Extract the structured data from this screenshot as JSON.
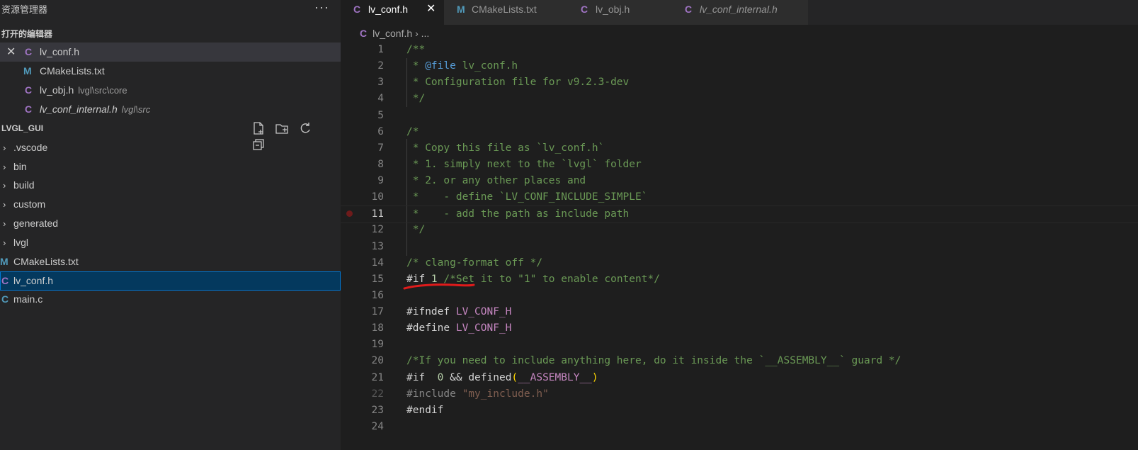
{
  "sidebar": {
    "title": "资源管理器",
    "more": "···",
    "open_editors_title": "打开的编辑器",
    "open_editors": [
      {
        "icon": "C",
        "name": "lv_conf.h",
        "desc": "",
        "close": "✕"
      },
      {
        "icon": "M",
        "name": "CMakeLists.txt",
        "desc": ""
      },
      {
        "icon": "C",
        "name": "lv_obj.h",
        "desc": "lvgl\\src\\core"
      },
      {
        "icon": "C",
        "name": "lv_conf_internal.h",
        "desc": "lvgl\\src"
      }
    ],
    "project_title": "LVGL_GUI",
    "tree": [
      {
        "chev": "›",
        "name": ".vscode"
      },
      {
        "chev": "›",
        "name": "bin"
      },
      {
        "chev": "›",
        "name": "build"
      },
      {
        "chev": "›",
        "name": "custom"
      },
      {
        "chev": "›",
        "name": "generated"
      },
      {
        "chev": "›",
        "name": "lvgl"
      },
      {
        "icon": "M",
        "name": "CMakeLists.txt"
      },
      {
        "icon": "C",
        "name": "lv_conf.h"
      },
      {
        "icon": "C",
        "name": "main.c"
      }
    ]
  },
  "tabs": [
    {
      "icon": "C",
      "label": "lv_conf.h",
      "close": "✕"
    },
    {
      "icon": "M",
      "label": "CMakeLists.txt"
    },
    {
      "icon": "C",
      "label": "lv_obj.h"
    },
    {
      "icon": "C",
      "label": "lv_conf_internal.h"
    }
  ],
  "breadcrumb": {
    "icon": "C",
    "file": "lv_conf.h",
    "sep": "›",
    "rest": "..."
  },
  "code": {
    "line_numbers": [
      "1",
      "2",
      "3",
      "4",
      "5",
      "6",
      "7",
      "8",
      "9",
      "10",
      "11",
      "12",
      "13",
      "14",
      "15",
      "16",
      "17",
      "18",
      "19",
      "20",
      "21",
      "22",
      "23",
      "24"
    ],
    "l1": "/**",
    "l2a": " * ",
    "l2b": "@file",
    "l2c": " lv_conf.h",
    "l3": " * Configuration file for v9.2.3-dev",
    "l4": " */",
    "l6": "/*",
    "l7": " * Copy this file as `lv_conf.h`",
    "l8": " * 1. simply next to the `lvgl` folder",
    "l9": " * 2. or any other places and",
    "l10": " *    - define `LV_CONF_INCLUDE_SIMPLE`",
    "l11": " *    - add the path as include path",
    "l12": " */",
    "l14": "/* clang-format off */",
    "l15a": "#if ",
    "l15b": "1",
    "l15c": " /*Set it to \"1\" to enable content*/",
    "l17a": "#ifndef ",
    "l17b": "LV_CONF_H",
    "l18a": "#define ",
    "l18b": "LV_CONF_H",
    "l20": "/*If you need to include anything here, do it inside the `__ASSEMBLY__` guard */",
    "l21a": "#if  ",
    "l21b": "0",
    "l21c": " && ",
    "l21d": "defined",
    "l21e": "(",
    "l21f": "__ASSEMBLY__",
    "l21g": ")",
    "l22a": "#include ",
    "l22b": "\"my_include.h\"",
    "l23": "#endif"
  }
}
